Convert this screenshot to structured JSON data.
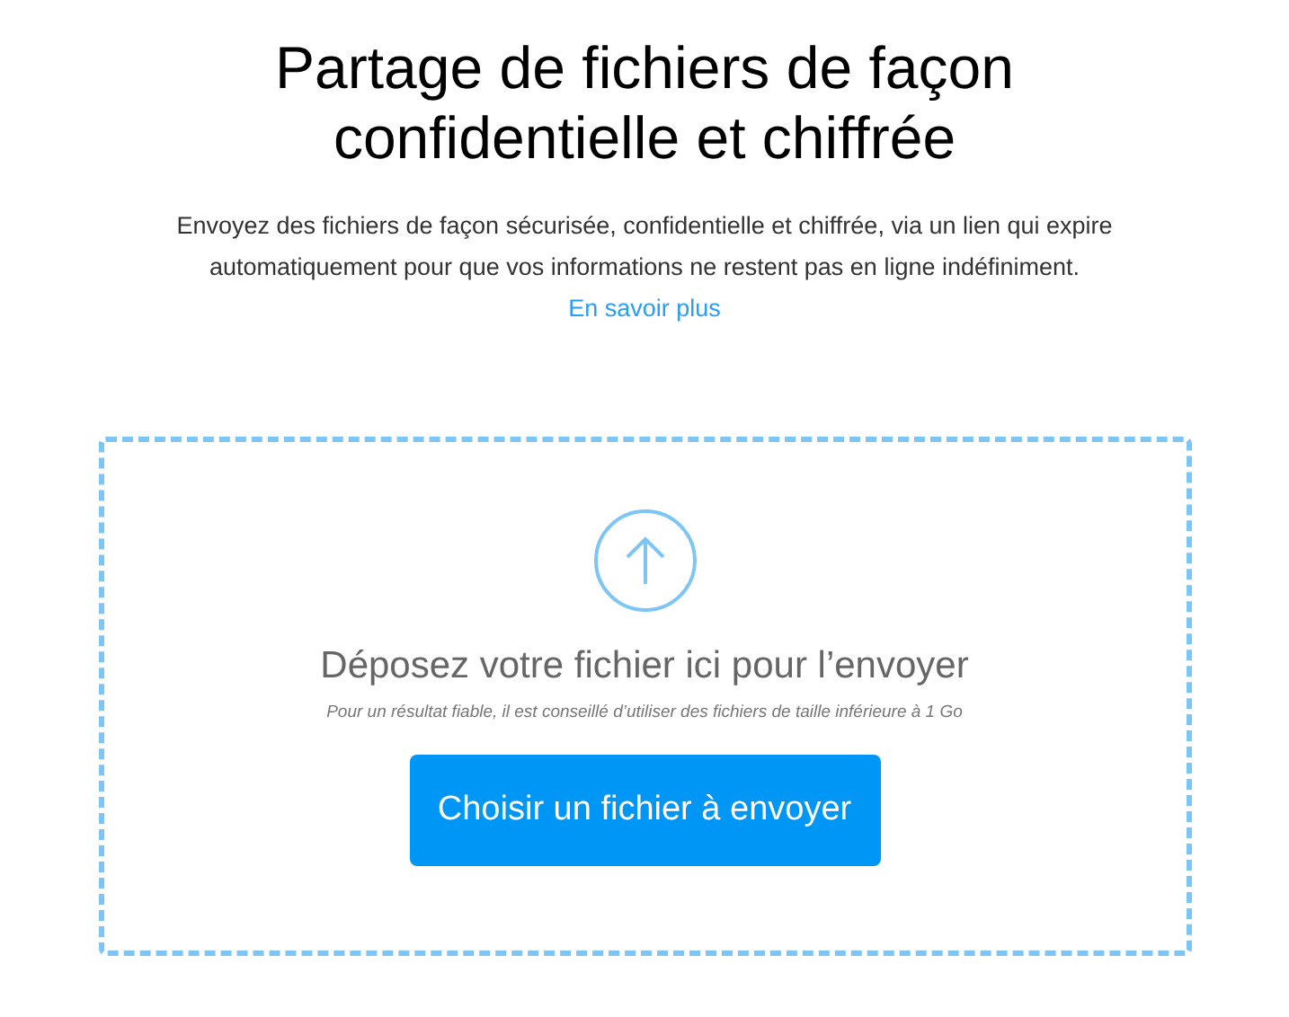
{
  "header": {
    "title": "Partage de fichiers de façon confidentielle et chiffrée",
    "description": "Envoyez des fichiers de façon sécurisée, confidentielle et chiffrée, via un lien qui expire automatiquement pour que vos informations ne restent pas en ligne indéfiniment.",
    "link": "En savoir plus"
  },
  "dropzone": {
    "heading": "Déposez votre fichier ici pour l’envoyer",
    "hint": "Pour un résultat fiable, il est conseillé d’utiliser des fichiers de taille inférieure à 1 Go",
    "button": "Choisir un fichier à envoyer"
  }
}
